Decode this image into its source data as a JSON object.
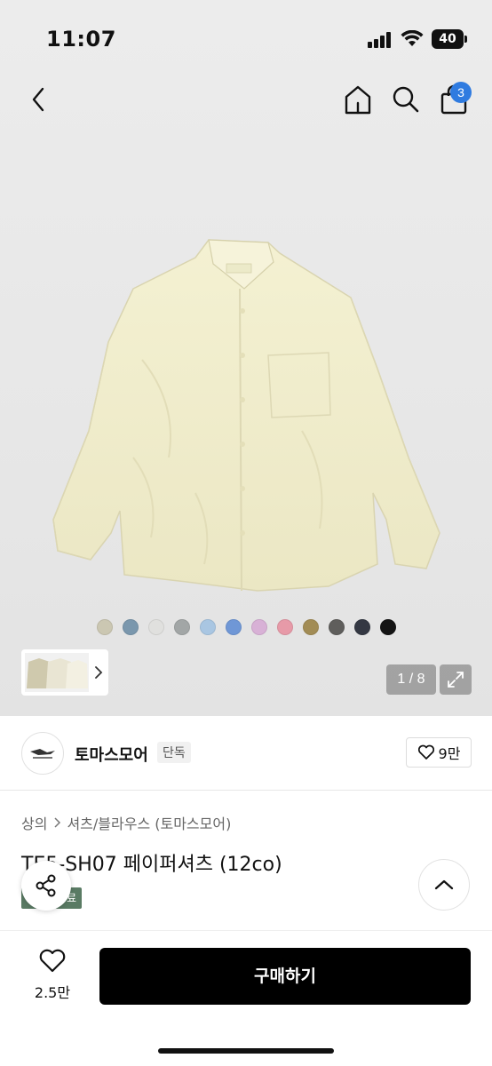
{
  "status_bar": {
    "time": "11:07",
    "battery": "40"
  },
  "nav": {
    "bag_count": "3"
  },
  "gallery": {
    "color_swatches": [
      "#cbc7b2",
      "#7a97ad",
      "#e0e0de",
      "#a2a6a6",
      "#a9c6e2",
      "#6f97d6",
      "#d8b1d6",
      "#e79aa8",
      "#a28c55",
      "#5f5e5c",
      "#343843",
      "#141414"
    ],
    "counter": "1 / 8"
  },
  "shop": {
    "name": "토마스모어",
    "badge": "단독",
    "likes": "9만"
  },
  "product": {
    "breadcrumb": [
      "상의",
      "셔츠/블라우스 (토마스모어)"
    ],
    "title": "TE5-SH07 페이퍼셔츠 (12co)",
    "tag": "료"
  },
  "bottom_bar": {
    "wish_count": "2.5만",
    "buy_label": "구매하기"
  }
}
